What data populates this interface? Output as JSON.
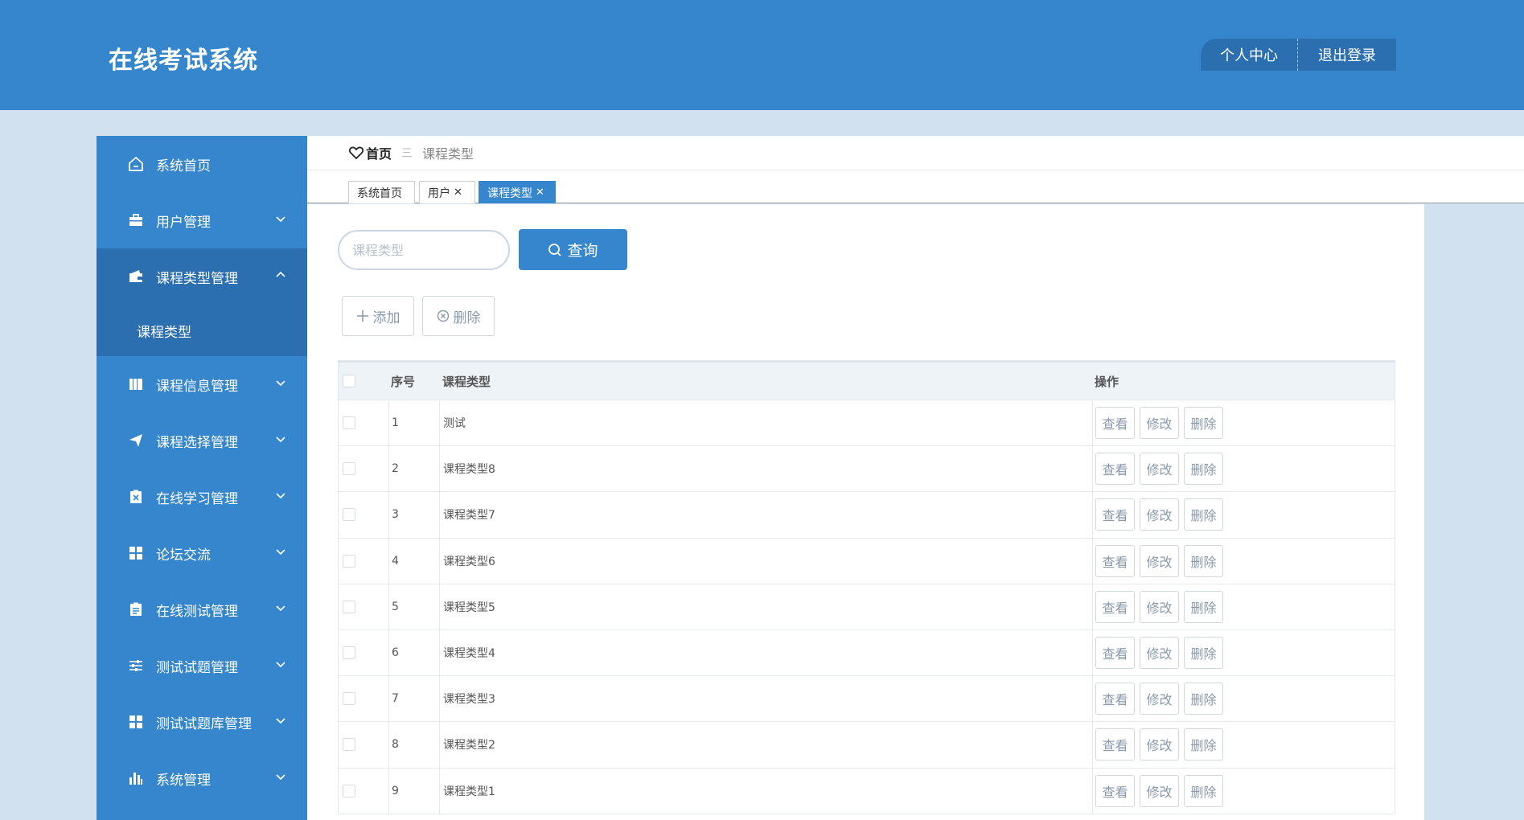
{
  "header": {
    "title": "在线考试系统",
    "profile_label": "个人中心",
    "logout_label": "退出登录"
  },
  "sidebar": {
    "items": [
      {
        "label": "系统首页",
        "icon": "home-icon"
      },
      {
        "label": "用户管理",
        "icon": "briefcase-icon"
      },
      {
        "label": "课程类型管理",
        "icon": "wallet-icon",
        "open": true
      },
      {
        "label": "课程信息管理",
        "icon": "book-icon"
      },
      {
        "label": "课程选择管理",
        "icon": "send-icon"
      },
      {
        "label": "在线学习管理",
        "icon": "clipboard-x-icon"
      },
      {
        "label": "论坛交流",
        "icon": "grid-icon"
      },
      {
        "label": "在线测试管理",
        "icon": "clipboard-icon"
      },
      {
        "label": "测试试题管理",
        "icon": "sliders-icon"
      },
      {
        "label": "测试试题库管理",
        "icon": "grid-icon"
      },
      {
        "label": "系统管理",
        "icon": "bar-chart-icon"
      }
    ],
    "submenu": {
      "label": "课程类型"
    }
  },
  "breadcrumb": {
    "home": "首页",
    "separator": "三",
    "current": "课程类型"
  },
  "tabs": [
    {
      "label": "系统首页",
      "closable": false
    },
    {
      "label": "用户",
      "closable": true
    },
    {
      "label": "课程类型",
      "closable": true,
      "active": true
    }
  ],
  "search": {
    "placeholder": "课程类型",
    "button_label": "查询"
  },
  "toolbar": {
    "add_label": "添加",
    "delete_label": "删除"
  },
  "table": {
    "columns": [
      "序号",
      "课程类型",
      "操作"
    ],
    "rows": [
      {
        "num": "1",
        "type": "测试"
      },
      {
        "num": "2",
        "type": "课程类型8"
      },
      {
        "num": "3",
        "type": "课程类型7"
      },
      {
        "num": "4",
        "type": "课程类型6"
      },
      {
        "num": "5",
        "type": "课程类型5"
      },
      {
        "num": "6",
        "type": "课程类型4"
      },
      {
        "num": "7",
        "type": "课程类型3"
      },
      {
        "num": "8",
        "type": "课程类型2"
      },
      {
        "num": "9",
        "type": "课程类型1"
      }
    ],
    "row_actions": [
      "查看",
      "修改",
      "删除"
    ]
  },
  "colors": {
    "primary": "#3586cc",
    "primary_dark": "#2b6fb0",
    "page_bg": "#d2e1f0"
  }
}
